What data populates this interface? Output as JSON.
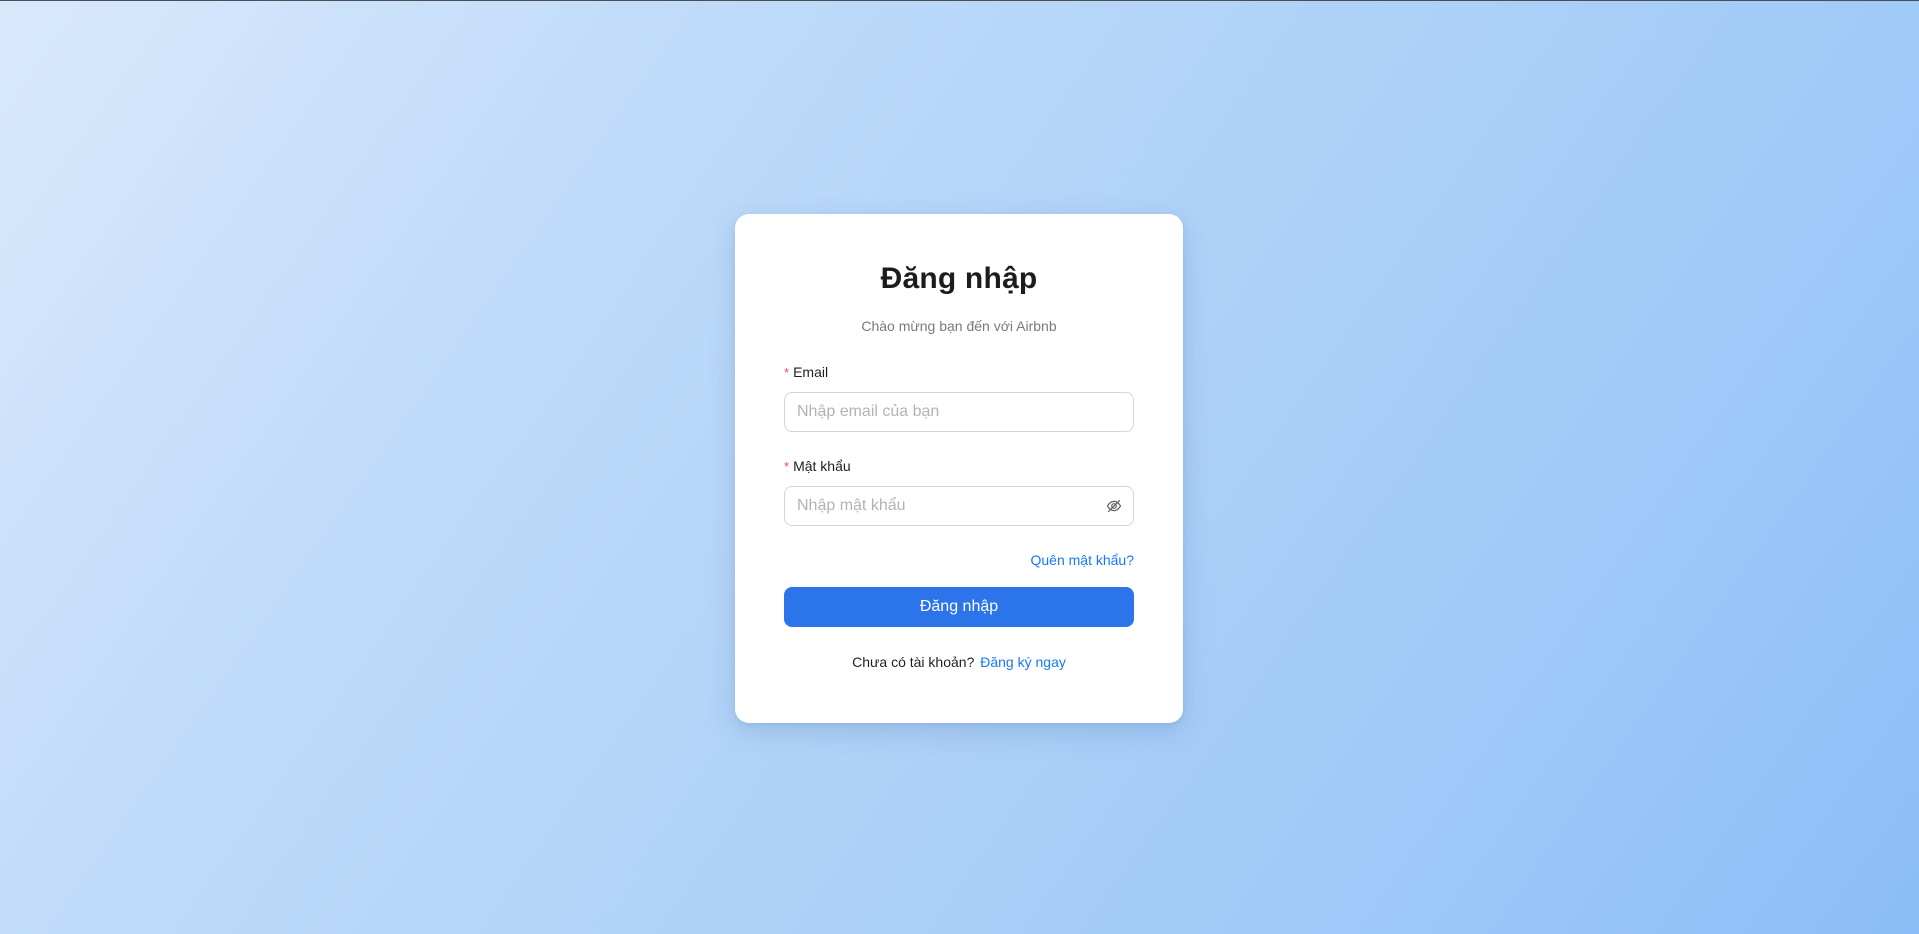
{
  "login": {
    "title": "Đăng nhập",
    "subtitle": "Chào mừng bạn đến với Airbnb",
    "required_mark": "*",
    "email_label": "Email",
    "email_placeholder": "Nhập email của bạn",
    "email_value": "",
    "password_label": "Mật khẩu",
    "password_placeholder": "Nhập mật khẩu",
    "password_value": "",
    "password_toggle_icon": "eye-invisible-icon",
    "forgot_link": "Quên mật khẩu?",
    "submit_label": "Đăng nhập",
    "no_account_text": "Chưa có tài khoản?",
    "register_link": "Đăng ký ngay"
  },
  "colors": {
    "primary": "#2c74ea",
    "link": "#1677ff",
    "required": "#ff4d4f",
    "background_start": "#d9e9fc",
    "background_end": "#8bbdf6"
  }
}
